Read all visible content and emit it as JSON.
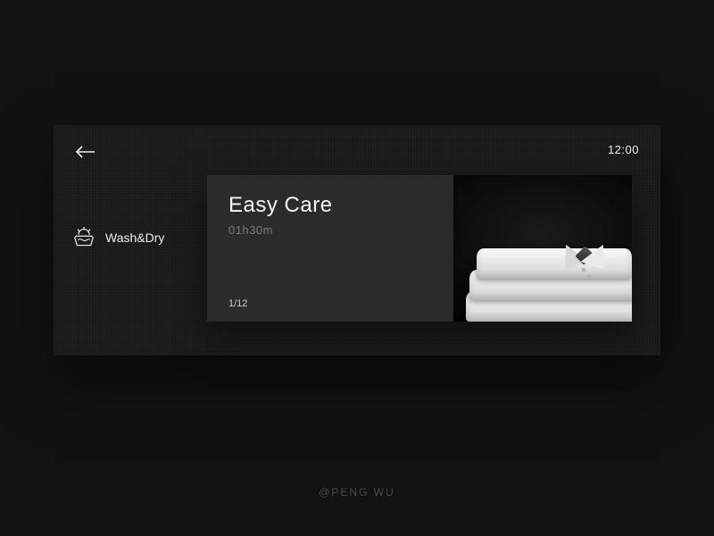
{
  "header": {
    "clock": "12:00"
  },
  "mode": {
    "icon": "wash-dry-icon",
    "label": "Wash&Dry"
  },
  "card": {
    "title": "Easy Care",
    "duration": "01h30m",
    "counter": "1/12",
    "image_subject": "folded-white-shirt"
  },
  "credit": "@PENG WU"
}
